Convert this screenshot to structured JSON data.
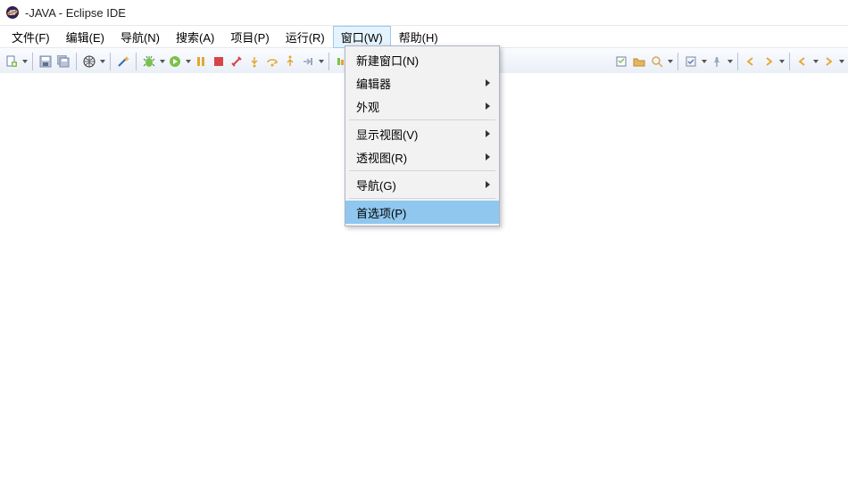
{
  "window": {
    "title": "-JAVA - Eclipse IDE"
  },
  "menubar": {
    "items": [
      {
        "label": "文件(F)"
      },
      {
        "label": "编辑(E)"
      },
      {
        "label": "导航(N)"
      },
      {
        "label": "搜索(A)"
      },
      {
        "label": "项目(P)"
      },
      {
        "label": "运行(R)"
      },
      {
        "label": "窗口(W)"
      },
      {
        "label": "帮助(H)"
      }
    ],
    "active_index": 6
  },
  "dropdown": {
    "items": [
      {
        "label": "新建窗口(N)",
        "submenu": false
      },
      {
        "label": "编辑器",
        "submenu": true
      },
      {
        "label": "外观",
        "submenu": true
      },
      {
        "sep": true
      },
      {
        "label": "显示视图(V)",
        "submenu": true
      },
      {
        "label": "透视图(R)",
        "submenu": true
      },
      {
        "sep": true
      },
      {
        "label": "导航(G)",
        "submenu": true
      },
      {
        "sep": true
      },
      {
        "label": "首选项(P)",
        "submenu": false,
        "selected": true
      }
    ]
  },
  "toolbar_icons": {
    "new": "new-file-icon",
    "save": "save-icon",
    "save_all": "save-all-icon",
    "globe": "globe-icon",
    "wand": "wand-icon",
    "debug": "debug-icon",
    "run": "run-icon",
    "pause": "pause-icon",
    "stop": "stop-icon",
    "disconnect": "disconnect-icon",
    "step_into": "step-into-icon",
    "step_over": "step-over-icon",
    "step_return": "step-return-icon",
    "resume": "resume-icon",
    "terminate": "terminate-icon",
    "new_pkg": "new-package-icon",
    "new_class": "new-class-icon",
    "open_type": "open-type-icon",
    "open_task": "open-task-icon",
    "search": "search-icon",
    "toggle": "toggle-icon",
    "pin": "pin-icon",
    "sync": "sync-icon",
    "back": "nav-back-icon",
    "forward": "nav-forward-icon"
  }
}
